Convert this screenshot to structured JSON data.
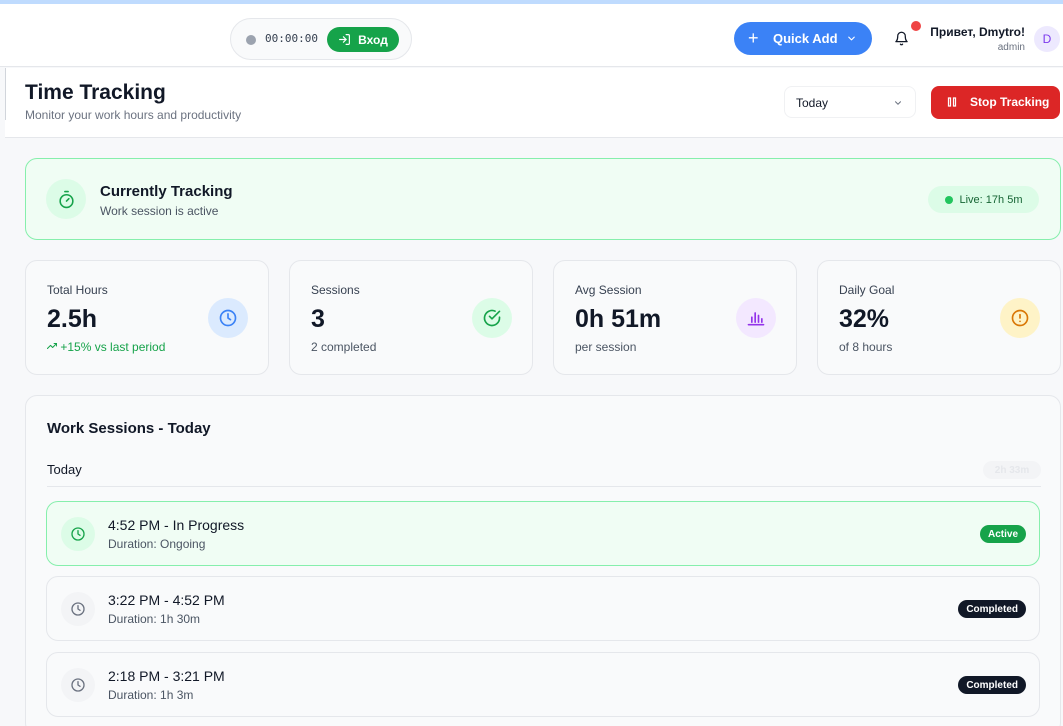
{
  "topbar": {
    "timer": "00:00:00",
    "login_label": "Вход",
    "quick_add_label": "Quick Add",
    "greeting": "Привет, Dmytro!",
    "role": "admin",
    "avatar_initial": "D"
  },
  "page": {
    "title": "Time Tracking",
    "subtitle": "Monitor your work hours and productivity",
    "period": "Today",
    "stop_label": "Stop Tracking"
  },
  "tracking": {
    "title": "Currently Tracking",
    "subtitle": "Work session is active",
    "live": "Live: 17h 5m"
  },
  "stats": [
    {
      "label": "Total Hours",
      "value": "2.5h",
      "note": "+15% vs last period",
      "icon": "clock-icon",
      "color": "#3b82f6"
    },
    {
      "label": "Sessions",
      "value": "3",
      "note": "2 completed",
      "icon": "check-circle-icon",
      "color": "#16a34a"
    },
    {
      "label": "Avg Session",
      "value": "0h 51m",
      "note": "per session",
      "icon": "bar-chart-icon",
      "color": "#9333ea"
    },
    {
      "label": "Daily Goal",
      "value": "32%",
      "note": "of 8 hours",
      "icon": "alert-circle-icon",
      "color": "#d97706"
    }
  ],
  "sessions": {
    "title": "Work Sessions - Today",
    "day_label": "Today",
    "day_total": "2h 33m",
    "items": [
      {
        "time": "4:52 PM - In Progress",
        "duration": "Duration: Ongoing",
        "status": "Active"
      },
      {
        "time": "3:22 PM - 4:52 PM",
        "duration": "Duration: 1h 30m",
        "status": "Completed"
      },
      {
        "time": "2:18 PM - 3:21 PM",
        "duration": "Duration: 1h 3m",
        "status": "Completed"
      }
    ]
  },
  "colors": {
    "primary": "#3b82f6",
    "success": "#16a34a",
    "danger": "#dc2626",
    "notification": "#ef4444"
  }
}
